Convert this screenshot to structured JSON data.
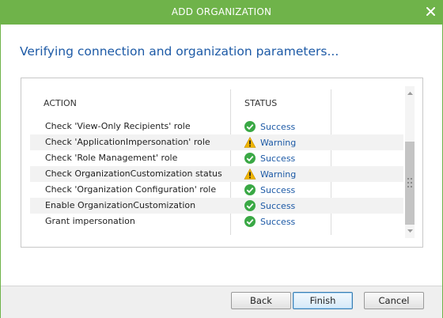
{
  "window": {
    "title": "ADD ORGANIZATION",
    "close_icon": "close-icon"
  },
  "heading": "Verifying connection and organization parameters...",
  "table": {
    "columns": [
      "ACTION",
      "STATUS"
    ],
    "rows": [
      {
        "action": "Check 'View-Only Recipients' role",
        "status": "Success",
        "icon": "success-check-icon"
      },
      {
        "action": "Check 'ApplicationImpersonation' role",
        "status": "Warning",
        "icon": "warning-icon"
      },
      {
        "action": "Check 'Role Management' role",
        "status": "Success",
        "icon": "success-check-icon"
      },
      {
        "action": "Check OrganizationCustomization status",
        "status": "Warning",
        "icon": "warning-icon"
      },
      {
        "action": "Check 'Organization Configuration' role",
        "status": "Success",
        "icon": "success-check-icon"
      },
      {
        "action": "Enable OrganizationCustomization",
        "status": "Success",
        "icon": "success-check-icon"
      },
      {
        "action": "Grant impersonation",
        "status": "Success",
        "icon": "success-check-icon"
      }
    ]
  },
  "buttons": {
    "back": "Back",
    "finish": "Finish",
    "cancel": "Cancel"
  },
  "colors": {
    "titlebar": "#6fb34a",
    "heading": "#1d5aa6",
    "status_text": "#1d5aa6",
    "success": "#3aa845",
    "warning": "#f0b400"
  }
}
